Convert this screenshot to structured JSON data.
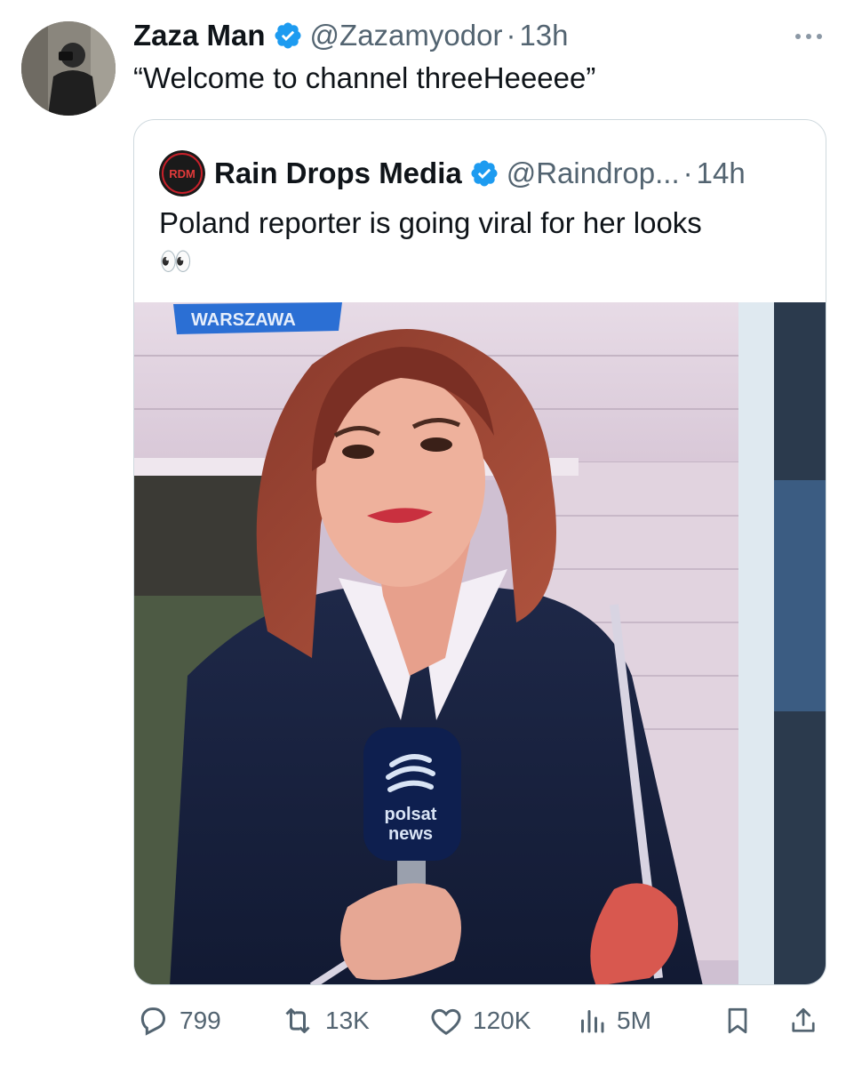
{
  "post": {
    "author_name": "Zaza Man",
    "author_handle": "@Zazamyodor",
    "separator": "·",
    "time": "13h",
    "text": "“Welcome to channel threeHeeeee”"
  },
  "quoted": {
    "author_name": "Rain Drops Media",
    "author_handle": "@Raindrop...",
    "separator": "·",
    "time": "14h",
    "avatar_text": "RDM",
    "text_line1": "Poland  reporter is going viral for her looks",
    "text_line2": "👀",
    "media": {
      "location_tag": "WARSZAWA",
      "mic_brand_line1": "polsat",
      "mic_brand_line2": "news"
    }
  },
  "actions": {
    "replies": "799",
    "reposts": "13K",
    "likes": "120K",
    "views": "5M"
  },
  "colors": {
    "text": "#0f1419",
    "secondary": "#536471",
    "verified": "#1d9bf0",
    "border": "#cfd9de"
  }
}
